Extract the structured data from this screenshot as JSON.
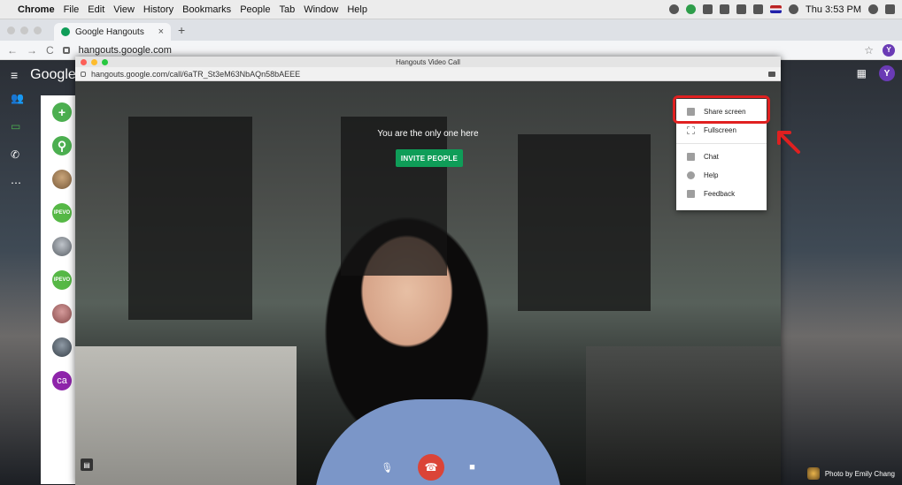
{
  "menubar": {
    "apple": "",
    "items": [
      "Chrome",
      "File",
      "Edit",
      "View",
      "History",
      "Bookmarks",
      "People",
      "Tab",
      "Window",
      "Help"
    ],
    "clock": "Thu 3:53 PM"
  },
  "browser": {
    "tab_title": "Google Hangouts",
    "tab_close": "×",
    "new_tab": "+",
    "url": "hangouts.google.com",
    "avatar_letter": "Y"
  },
  "hangouts": {
    "brand": "Google",
    "avatar_letter": "Y",
    "contacts": [
      {
        "style": "green",
        "text": "+"
      },
      {
        "style": "green",
        "text": "⚲"
      },
      {
        "style": "photo1",
        "text": ""
      },
      {
        "style": "ipevo",
        "text": "IPEVO"
      },
      {
        "style": "photo2",
        "text": ""
      },
      {
        "style": "ipevo",
        "text": "IPEVO"
      },
      {
        "style": "photo3",
        "text": ""
      },
      {
        "style": "photo4",
        "text": ""
      },
      {
        "style": "purple",
        "text": "ca"
      }
    ]
  },
  "call_window": {
    "title": "Hangouts Video Call",
    "url": "hangouts.google.com/call/6aTR_St3eM63NbAQn58bAEEE",
    "only_one": "You are the only one here",
    "invite_button": "INVITE PEOPLE"
  },
  "menu": {
    "items": [
      "Share screen",
      "Fullscreen",
      "Chat",
      "Help",
      "Feedback"
    ]
  },
  "colors": {
    "accent_green": "#0f9d58",
    "hangup_red": "#db4437",
    "highlight_red": "#e02020"
  },
  "credit": "Photo by Emily Chang"
}
